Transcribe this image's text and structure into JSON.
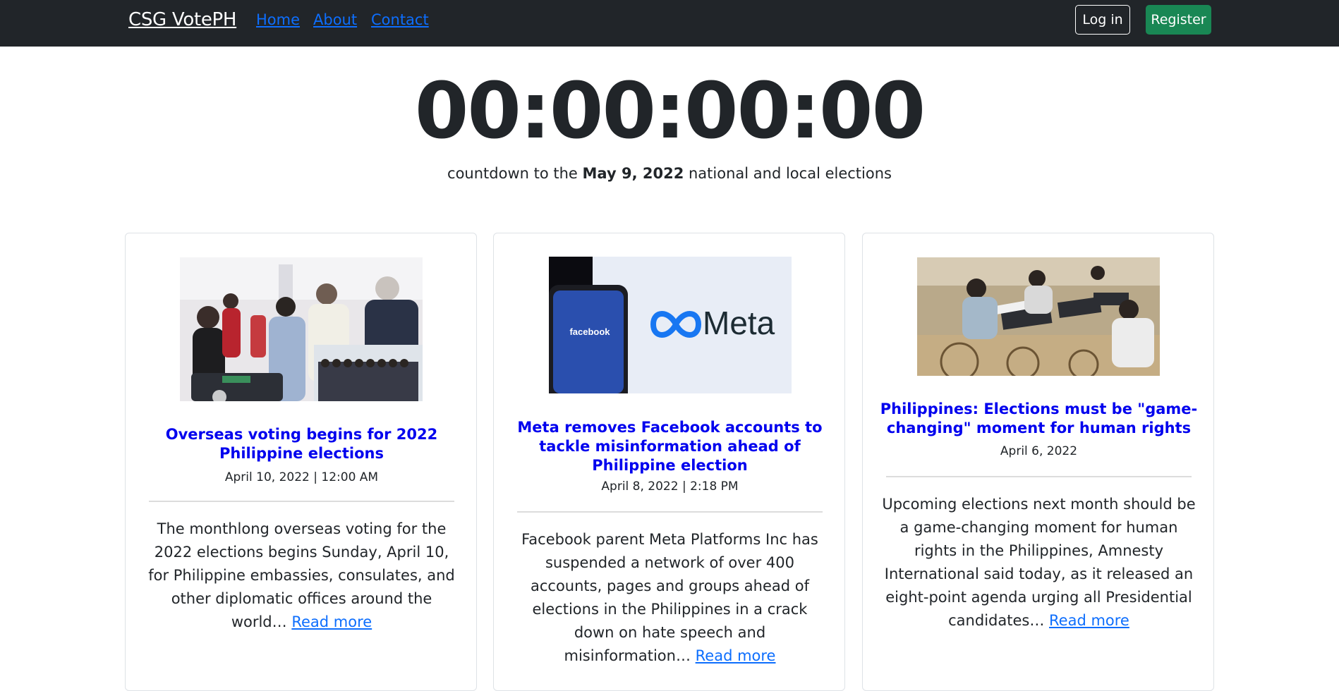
{
  "nav": {
    "brand": "CSG VotePH",
    "links": [
      "Home",
      "About",
      "Contact"
    ],
    "login_label": "Log in",
    "register_label": "Register"
  },
  "countdown": {
    "time": "00:00:00:00",
    "prefix": "countdown to the",
    "date": "May 9, 2022",
    "suffix": "national and local elections"
  },
  "articles": [
    {
      "title": "Overseas voting begins for 2022 Philippine elections",
      "date": "April 10, 2022 | 12:00 AM",
      "excerpt": "The monthlong overseas voting for the 2022 elections begins Sunday, April 10, for Philippine embassies, consulates, and other diplomatic offices around the world…",
      "read_more": "Read more"
    },
    {
      "title": "Meta removes Facebook accounts to tackle misinformation ahead of Philippine election",
      "date": "April 8, 2022 | 2:18 PM",
      "excerpt": "Facebook parent Meta Platforms Inc has suspended a network of over 400 accounts, pages and groups ahead of elections in the Philippines in a crack down on hate speech and misinformation…",
      "read_more": "Read more",
      "image_text": [
        "Meta",
        "facebook"
      ]
    },
    {
      "title": "Philippines: Elections must be \"game-changing\" moment for human rights",
      "date": "April 6, 2022",
      "excerpt": "Upcoming elections next month should be a game-changing moment for human rights in the Philippines, Amnesty International said today, as it released an eight-point agenda urging all Presidential candidates…",
      "read_more": "Read more"
    }
  ]
}
